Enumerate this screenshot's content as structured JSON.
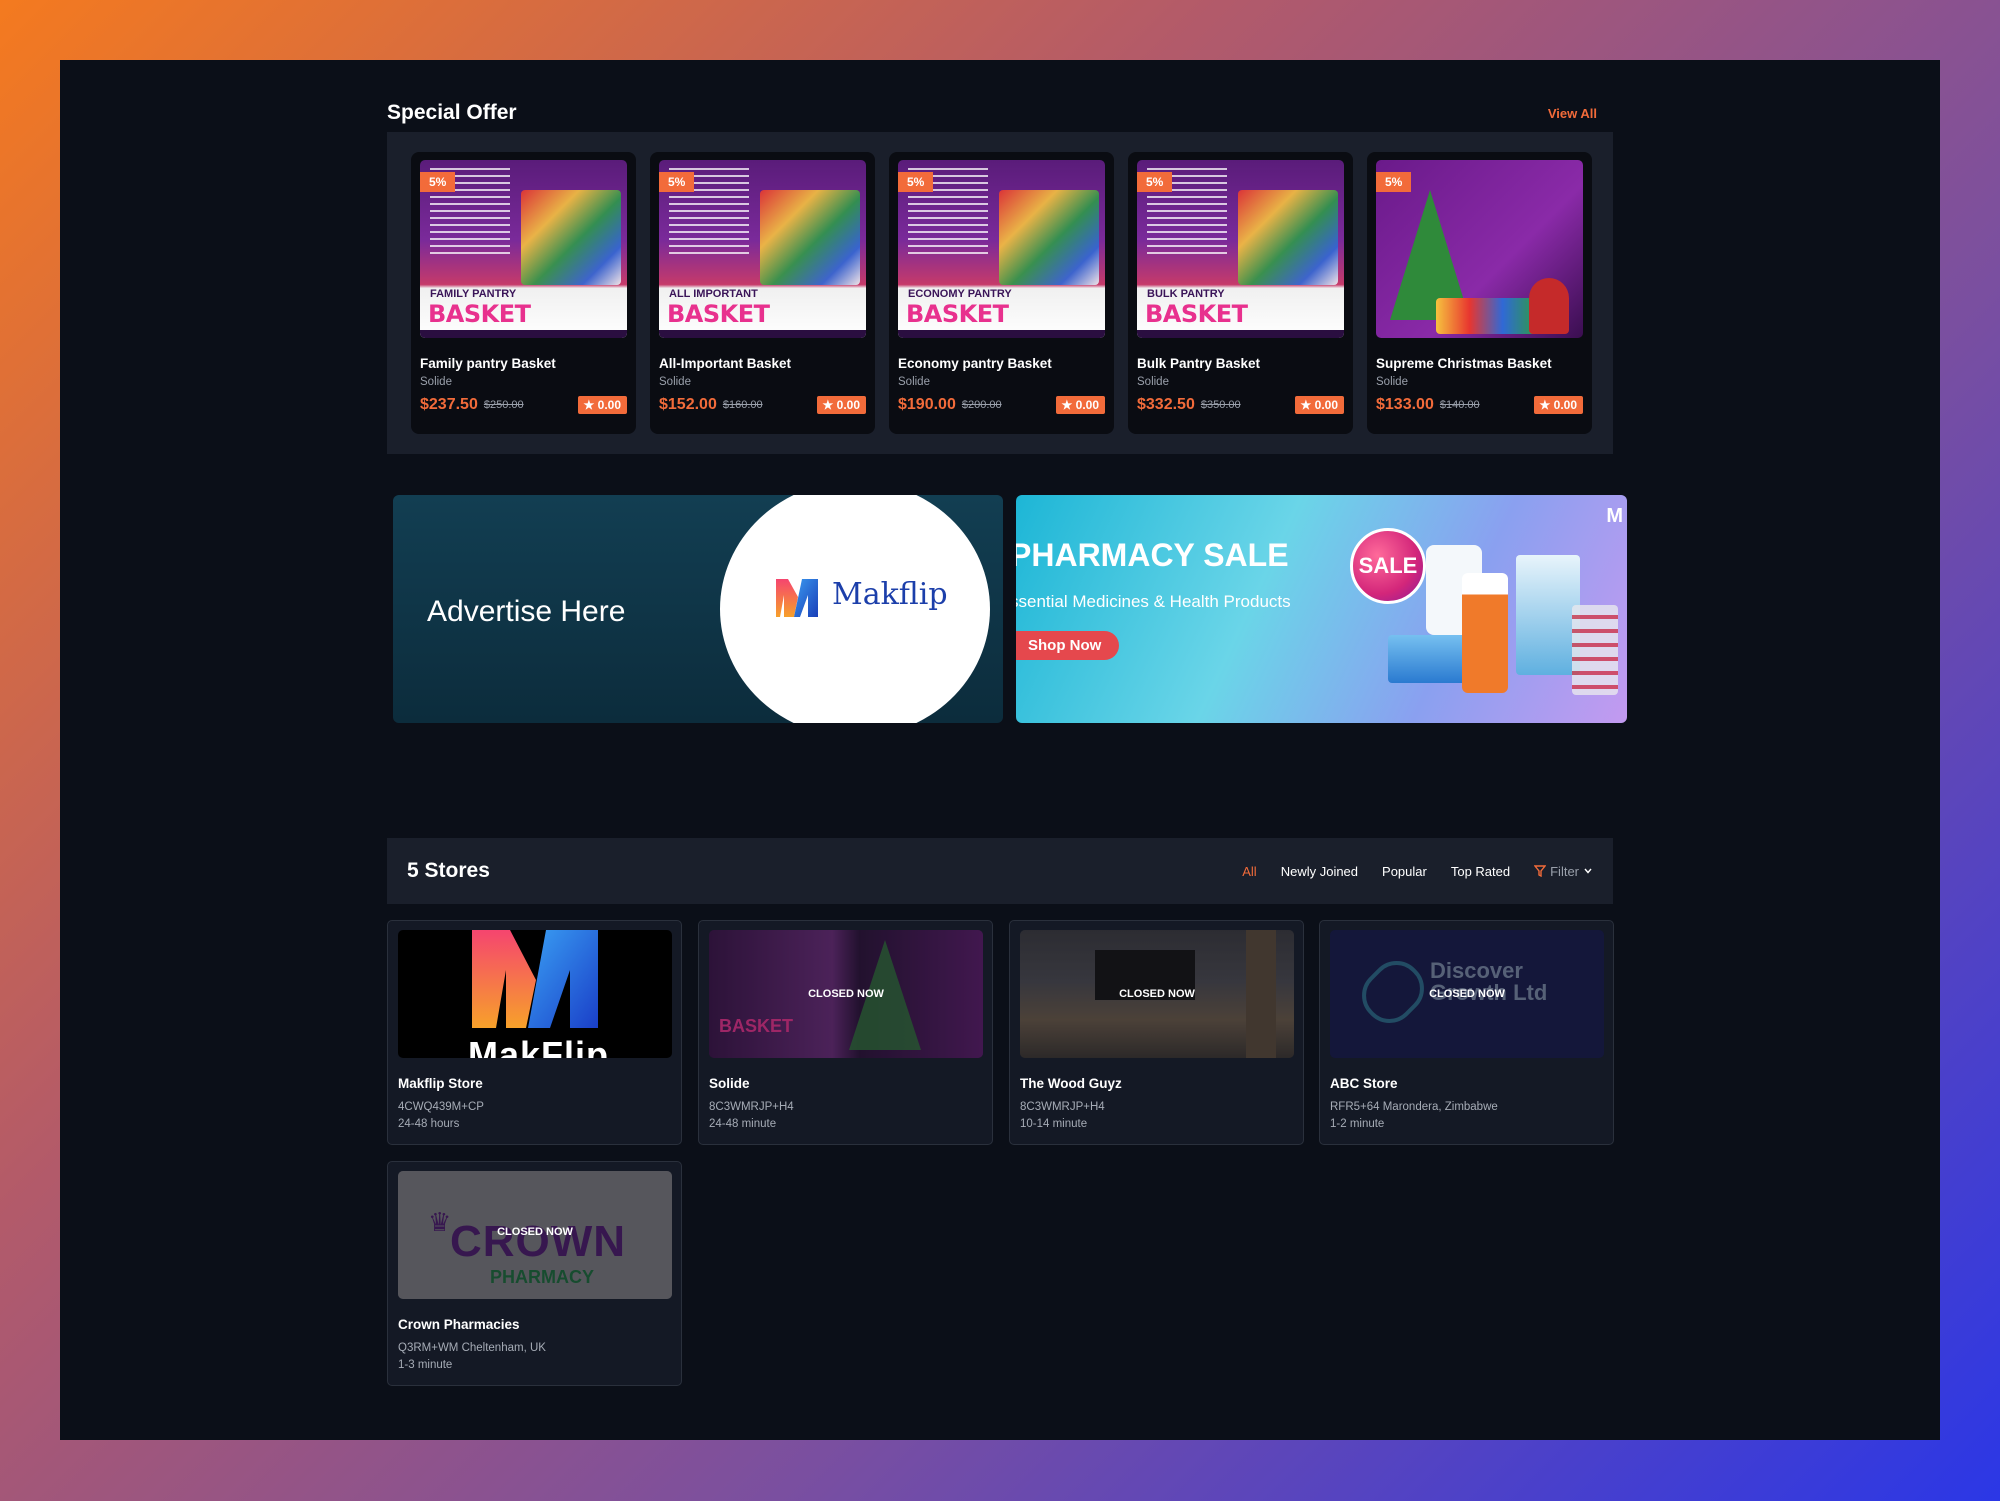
{
  "special_offer": {
    "title": "Special Offer",
    "view_all": "View All",
    "products": [
      {
        "discount": "5%",
        "name": "Family pantry Basket",
        "store": "Solide",
        "price": "$237.50",
        "old_price": "$250.00",
        "rating": "★ 0.00",
        "img_title": "BASKET",
        "img_sub": "FAMILY PANTRY"
      },
      {
        "discount": "5%",
        "name": "All-Important Basket",
        "store": "Solide",
        "price": "$152.00",
        "old_price": "$160.00",
        "rating": "★ 0.00",
        "img_title": "BASKET",
        "img_sub": "ALL IMPORTANT"
      },
      {
        "discount": "5%",
        "name": "Economy pantry Basket",
        "store": "Solide",
        "price": "$190.00",
        "old_price": "$200.00",
        "rating": "★ 0.00",
        "img_title": "BASKET",
        "img_sub": "ECONOMY PANTRY"
      },
      {
        "discount": "5%",
        "name": "Bulk Pantry Basket",
        "store": "Solide",
        "price": "$332.50",
        "old_price": "$350.00",
        "rating": "★ 0.00",
        "img_title": "BASKET",
        "img_sub": "BULK PANTRY"
      },
      {
        "discount": "5%",
        "name": "Supreme Christmas Basket",
        "store": "Solide",
        "price": "$133.00",
        "old_price": "$140.00",
        "rating": "★ 0.00"
      }
    ]
  },
  "banners": {
    "ad": {
      "text": "Advertise Here",
      "logo_text": "Makflip"
    },
    "pharmacy": {
      "title": "PHARMACY SALE",
      "subtitle": "ssential Medicines & Health Products",
      "button": "Shop Now",
      "sale_badge": "SALE",
      "mark": "M"
    }
  },
  "stores": {
    "title": "5 Stores",
    "tabs": [
      "All",
      "Newly Joined",
      "Popular",
      "Top Rated"
    ],
    "filter_label": "Filter",
    "items": [
      {
        "name": "Makflip Store",
        "address": "4CWQ439M+CP",
        "time": "24-48 hours",
        "closed": "",
        "img_text": "MakFlip"
      },
      {
        "name": "Solide",
        "address": "8C3WMRJP+H4",
        "time": "24-48 minute",
        "closed": "CLOSED NOW",
        "img_text": "BASKET"
      },
      {
        "name": "The Wood Guyz",
        "address": "8C3WMRJP+H4",
        "time": "10-14 minute",
        "closed": "CLOSED NOW"
      },
      {
        "name": "ABC Store",
        "address": "RFR5+64 Marondera, Zimbabwe",
        "time": "1-2 minute",
        "closed": "CLOSED NOW",
        "img_text": "Discover Growth Ltd"
      },
      {
        "name": "Crown Pharmacies",
        "address": "Q3RM+WM Cheltenham, UK",
        "time": "1-3 minute",
        "closed": "CLOSED NOW",
        "img_text": "CROWN",
        "img_sub": "PHARMACY"
      }
    ]
  },
  "colors": {
    "accent": "#f26b3a",
    "background": "#0b0f18",
    "panel": "#1a1f2b"
  }
}
